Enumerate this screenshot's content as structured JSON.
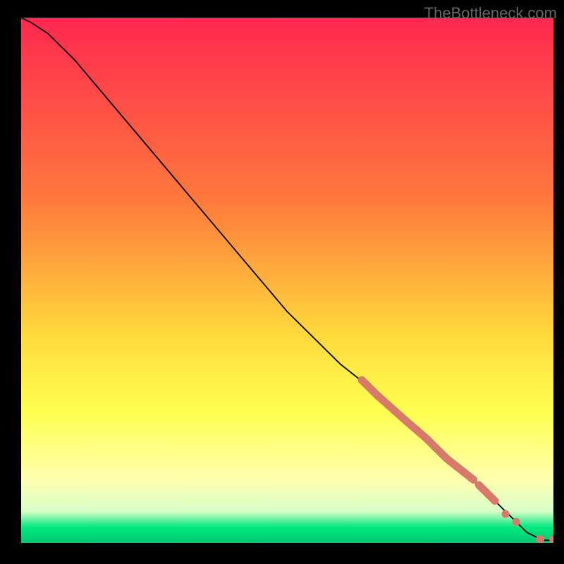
{
  "watermark": "TheBottleneck.com",
  "chart_data": {
    "type": "line",
    "title": "",
    "xlabel": "",
    "ylabel": "",
    "xlim": [
      0,
      100
    ],
    "ylim": [
      0,
      100
    ],
    "gradient_stops": [
      {
        "offset": 0,
        "color": "#ff2850"
      },
      {
        "offset": 35,
        "color": "#ff7a3c"
      },
      {
        "offset": 60,
        "color": "#ffd83c"
      },
      {
        "offset": 75,
        "color": "#ffff50"
      },
      {
        "offset": 88,
        "color": "#ffffb0"
      },
      {
        "offset": 94,
        "color": "#d8ffc8"
      },
      {
        "offset": 97,
        "color": "#00e980"
      },
      {
        "offset": 100,
        "color": "#00c870"
      }
    ],
    "curve": {
      "x": [
        0,
        2,
        5,
        10,
        20,
        30,
        40,
        50,
        60,
        65,
        70,
        75,
        80,
        85,
        88,
        92,
        95,
        98,
        100
      ],
      "y": [
        100,
        99,
        97,
        92,
        80,
        68,
        56,
        44,
        34,
        30,
        25,
        21,
        16,
        12,
        9,
        5,
        2,
        0.5,
        0.5
      ]
    },
    "marker_segments": [
      {
        "x_start": 64,
        "x_end": 67,
        "y_start": 31,
        "y_end": 28
      },
      {
        "x_start": 67,
        "x_end": 72,
        "y_start": 28,
        "y_end": 23.5
      },
      {
        "x_start": 72,
        "x_end": 76,
        "y_start": 23.5,
        "y_end": 20
      },
      {
        "x_start": 76,
        "x_end": 80,
        "y_start": 20,
        "y_end": 16
      },
      {
        "x_start": 80,
        "x_end": 85,
        "y_start": 16,
        "y_end": 12
      },
      {
        "x_start": 86,
        "x_end": 89,
        "y_start": 11,
        "y_end": 8
      }
    ],
    "marker_points": [
      {
        "x": 91,
        "y": 5.5
      },
      {
        "x": 93,
        "y": 4
      }
    ],
    "end_points": [
      {
        "x": 97.5,
        "y": 0.7
      },
      {
        "x": 100,
        "y": 0.7
      }
    ],
    "marker_color": "#d87a6a"
  }
}
